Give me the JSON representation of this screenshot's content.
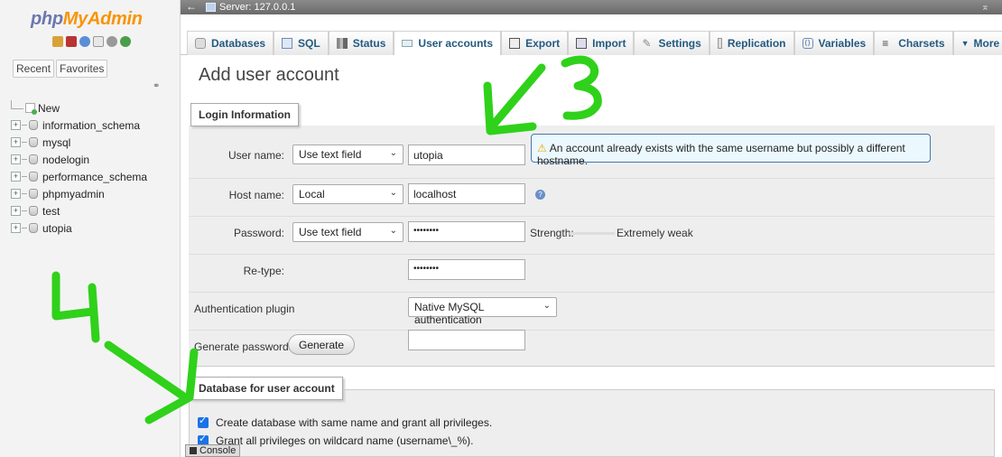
{
  "logo": {
    "part1": "php",
    "part2": "MyAdmin"
  },
  "nav": {
    "tabs": [
      "Recent",
      "Favorites"
    ],
    "tree": [
      {
        "label": "New",
        "kind": "new"
      },
      {
        "label": "information_schema",
        "kind": "db"
      },
      {
        "label": "mysql",
        "kind": "db"
      },
      {
        "label": "nodelogin",
        "kind": "db"
      },
      {
        "label": "performance_schema",
        "kind": "db"
      },
      {
        "label": "phpmyadmin",
        "kind": "db"
      },
      {
        "label": "test",
        "kind": "db"
      },
      {
        "label": "utopia",
        "kind": "db"
      }
    ]
  },
  "serverbar": {
    "label": "Server: 127.0.0.1"
  },
  "menu": {
    "databases": "Databases",
    "sql": "SQL",
    "status": "Status",
    "user_accounts": "User accounts",
    "export": "Export",
    "import": "Import",
    "settings": "Settings",
    "replication": "Replication",
    "variables": "Variables",
    "charsets": "Charsets",
    "more": "More"
  },
  "page": {
    "title": "Add user account"
  },
  "login": {
    "legend": "Login Information",
    "username_label": "User name:",
    "username_type": "Use text field",
    "username_value": "utopia",
    "notice": "An account already exists with the same username but possibly a different hostname.",
    "hostname_label": "Host name:",
    "hostname_type": "Local",
    "hostname_value": "localhost",
    "password_label": "Password:",
    "password_type": "Use text field",
    "password_value": "••••••••",
    "strength_label": "Strength:",
    "strength_value": "Extremely weak",
    "retype_label": "Re-type:",
    "retype_value": "••••••••",
    "auth_label": "Authentication plugin",
    "auth_value": "Native MySQL authentication",
    "genpass_label": "Generate password:",
    "generate_button": "Generate"
  },
  "dbsection": {
    "legend": "Database for user account",
    "opt1": "Create database with same name and grant all privileges.",
    "opt2": "Grant all privileges on wildcard name (username\\_%)."
  },
  "console": {
    "label": "Console"
  },
  "annotations": {
    "mark1": "3",
    "mark2": "4"
  },
  "colors": {
    "annotation": "#2fd11a",
    "link": "#235a81",
    "notice_border": "#4477aa"
  }
}
